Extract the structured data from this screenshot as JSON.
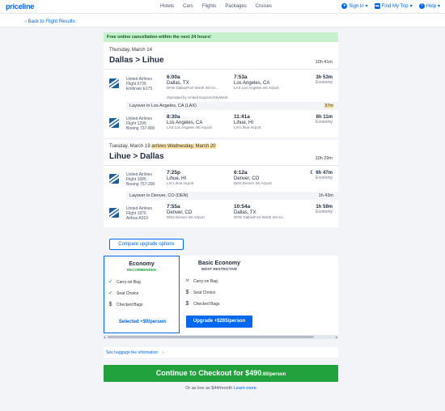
{
  "header": {
    "logo": "priceline",
    "nav": [
      "Hotels",
      "Cars",
      "Flights",
      "Packages",
      "Cruises"
    ],
    "sign_in": "Sign in",
    "find_trip": "Find My Trip",
    "help": "Help"
  },
  "back_link": "Back to Flight Results",
  "banner": "Free online cancellation within the next 24 hours!",
  "outbound": {
    "date": "Thursday, March 14",
    "route": "Dallas > Lihue",
    "duration": "10h 41m",
    "segments": [
      {
        "airline": "United Airlines",
        "flight": "Flight 5736",
        "aircraft": "Embraer E175",
        "dep_time": "6:00a",
        "dep_city": "Dallas, TX",
        "dep_airport": "DFW Dallas/Fort Worth Intl Air...",
        "arr_time": "7:53a",
        "arr_city": "Los Angeles, CA",
        "arr_airport": "LAX Los Angeles Intl Airport",
        "seg_duration": "3h 53m",
        "cabin": "Economy",
        "operated_by": "Operated by United Express/SkyWest"
      },
      {
        "airline": "United Airlines",
        "flight": "Flight 1295",
        "aircraft": "Boeing 737-800",
        "dep_time": "8:30a",
        "dep_city": "Los Angeles, CA",
        "dep_airport": "LAX Los Angeles Intl Airport",
        "arr_time": "11:41a",
        "arr_city": "Lihue, HI",
        "arr_airport": "LIH Lihue Airport",
        "seg_duration": "6h 11m",
        "cabin": "Economy"
      }
    ],
    "layover": "Layover in Los Angeles, CA (LAX)",
    "layover_time": "37m"
  },
  "return": {
    "date": "Tuesday, March 19",
    "arrives_note": "arrives Wednesday, March 20",
    "route": "Lihue > Dallas",
    "duration": "10h 29m",
    "segments": [
      {
        "airline": "United Airlines",
        "flight": "Flight 1685",
        "aircraft": "Boeing 757-200",
        "dep_time": "7:25p",
        "dep_city": "Lihue, HI",
        "dep_airport": "LIH Lihue Airport",
        "arr_time": "6:12a",
        "arr_city": "Denver, CO",
        "arr_airport": "DEN Denver Intl Airport",
        "seg_duration": "6h 47m",
        "cabin": "Economy"
      },
      {
        "airline": "United Airlines",
        "flight": "Flight 1876",
        "aircraft": "Airbus A319",
        "dep_time": "7:55a",
        "dep_city": "Denver, CO",
        "dep_airport": "DEN Denver Intl Airport",
        "arr_time": "10:54a",
        "arr_city": "Dallas, TX",
        "arr_airport": "DFW Dallas/Fort Worth Intl Air...",
        "seg_duration": "1h 59m",
        "cabin": "Economy"
      }
    ],
    "layover": "Layover in Denver, CO (DEN)",
    "layover_time": "1h 43m"
  },
  "compare_button": "Compare upgrade options",
  "fares": {
    "economy": {
      "title": "Economy",
      "tag": "RECOMMENDED",
      "features": [
        "Carry-on Bag",
        "Seat Choice",
        "Checked Bags"
      ],
      "action": "Selected +$0/person"
    },
    "basic": {
      "title": "Basic Economy",
      "tag": "MOST RESTRICTIVE",
      "features": [
        "Carry-on Bag",
        "Seat Choice",
        "Checked Bags"
      ],
      "action": "Upgrade +$265/person"
    }
  },
  "baggage_link": "See baggage fee information",
  "checkout": {
    "label": "Continue to Checkout for $490",
    "cents": ".60/person"
  },
  "financing": {
    "text": "Or as low as $44/month",
    "link": "Learn more"
  },
  "colors": {
    "brand": "#0068ef",
    "checkout": "#21a23d",
    "banner": "#c7f0cd",
    "highlight": "#fde4a8"
  }
}
